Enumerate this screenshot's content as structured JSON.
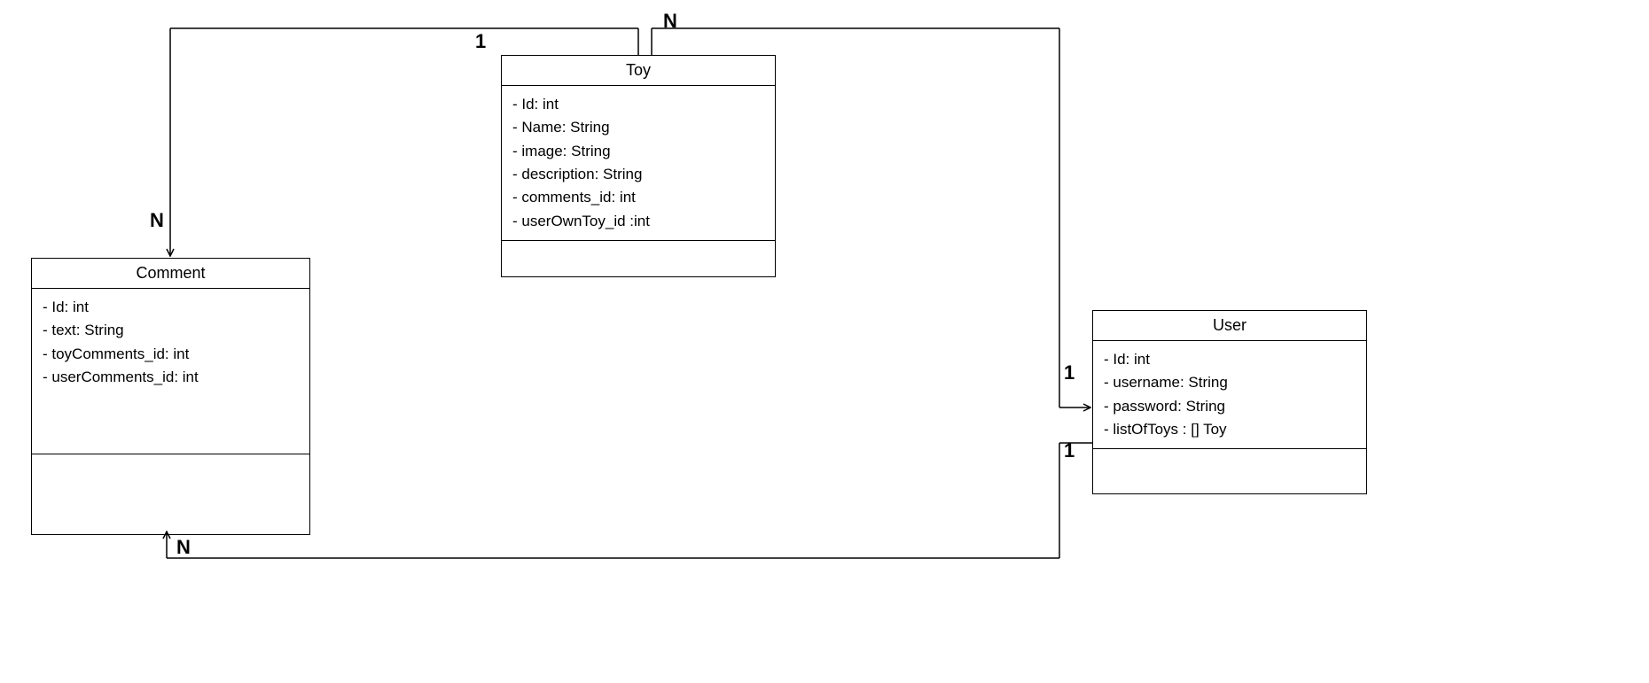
{
  "classes": {
    "toy": {
      "name": "Toy",
      "attrs": [
        "- Id: int",
        "- Name: String",
        "- image: String",
        "- description: String",
        "- comments_id: int",
        "- userOwnToy_id :int"
      ]
    },
    "comment": {
      "name": "Comment",
      "attrs": [
        "- Id: int",
        "- text: String",
        "- toyComments_id: int",
        "- userComments_id: int"
      ]
    },
    "user": {
      "name": "User",
      "attrs": [
        "- Id: int",
        "- username: String",
        "- password: String",
        "- listOfToys : [] Toy"
      ]
    }
  },
  "cardinalities": {
    "toy_comment_toy_side": "1",
    "toy_comment_comment_side": "N",
    "toy_user_toy_side": "N",
    "toy_user_user_side": "1",
    "user_comment_user_side": "1",
    "user_comment_comment_side": "N"
  },
  "relationships": [
    {
      "from": "Toy",
      "to": "Comment",
      "from_card": "1",
      "to_card": "N",
      "direction": "to"
    },
    {
      "from": "Toy",
      "to": "User",
      "from_card": "N",
      "to_card": "1",
      "direction": "to"
    },
    {
      "from": "User",
      "to": "Comment",
      "from_card": "1",
      "to_card": "N",
      "direction": "to"
    }
  ]
}
